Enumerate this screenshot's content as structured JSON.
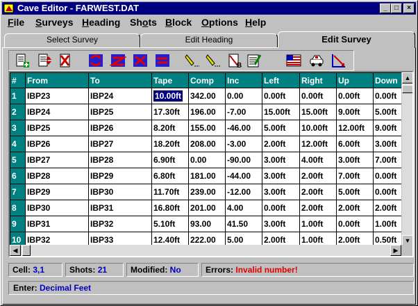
{
  "window": {
    "title": "Cave Editor - FARWEST.DAT"
  },
  "menu": [
    "File",
    "Surveys",
    "Heading",
    "Shots",
    "Block",
    "Options",
    "Help"
  ],
  "menu_underline": [
    "F",
    "S",
    "H",
    "o",
    "B",
    "O",
    "H"
  ],
  "tabs": [
    "Select Survey",
    "Edit Heading",
    "Edit Survey"
  ],
  "toolbar_icons": [
    "append-shot-icon",
    "insert-shot-icon",
    "delete-shot-icon",
    "reverse-shot-icon",
    "reverse-survey-icon",
    "convert-icon",
    "swap-icon",
    "erase-shots-icon",
    "clear-lrud-icon",
    "backsight-icon",
    "notes-icon",
    "flag-icon",
    "car-icon",
    "plot-icon"
  ],
  "grid": {
    "headers": [
      "#",
      "From",
      "To",
      "Tape",
      "Comp",
      "Inc",
      "Left",
      "Right",
      "Up",
      "Down"
    ],
    "rows": [
      [
        "1",
        "IBP23",
        "IBP24",
        "10.00ft",
        "342.00",
        "0.00",
        "0.00ft",
        "0.00ft",
        "0.00ft",
        "0.00ft"
      ],
      [
        "2",
        "IBP24",
        "IBP25",
        "17.30ft",
        "196.00",
        "-7.00",
        "15.00ft",
        "15.00ft",
        "9.00ft",
        "5.00ft"
      ],
      [
        "3",
        "IBP25",
        "IBP26",
        "8.20ft",
        "155.00",
        "-46.00",
        "5.00ft",
        "10.00ft",
        "12.00ft",
        "9.00ft"
      ],
      [
        "4",
        "IBP26",
        "IBP27",
        "18.20ft",
        "208.00",
        "-3.00",
        "2.00ft",
        "12.00ft",
        "6.00ft",
        "3.00ft"
      ],
      [
        "5",
        "IBP27",
        "IBP28",
        "6.90ft",
        "0.00",
        "-90.00",
        "3.00ft",
        "4.00ft",
        "3.00ft",
        "7.00ft"
      ],
      [
        "6",
        "IBP28",
        "IBP29",
        "6.80ft",
        "181.00",
        "-44.00",
        "3.00ft",
        "2.00ft",
        "7.00ft",
        "0.00ft"
      ],
      [
        "7",
        "IBP29",
        "IBP30",
        "11.70ft",
        "239.00",
        "-12.00",
        "3.00ft",
        "2.00ft",
        "5.00ft",
        "0.00ft"
      ],
      [
        "8",
        "IBP30",
        "IBP31",
        "16.80ft",
        "201.00",
        "4.00",
        "0.00ft",
        "2.00ft",
        "2.00ft",
        "2.00ft"
      ],
      [
        "9",
        "IBP31",
        "IBP32",
        "5.10ft",
        "93.00",
        "41.50",
        "3.00ft",
        "1.00ft",
        "0.00ft",
        "1.00ft"
      ],
      [
        "10",
        "IBP32",
        "IBP33",
        "12.40ft",
        "222.00",
        "5.00",
        "2.00ft",
        "1.00ft",
        "2.00ft",
        "0.50ft"
      ]
    ]
  },
  "status": {
    "cell_label": "Cell:",
    "cell_value": "3,1",
    "shots_label": "Shots:",
    "shots_value": "21",
    "modified_label": "Modified:",
    "modified_value": "No",
    "errors_label": "Errors:",
    "errors_value": "Invalid number!",
    "enter_label": "Enter:",
    "enter_value": "Decimal Feet"
  }
}
